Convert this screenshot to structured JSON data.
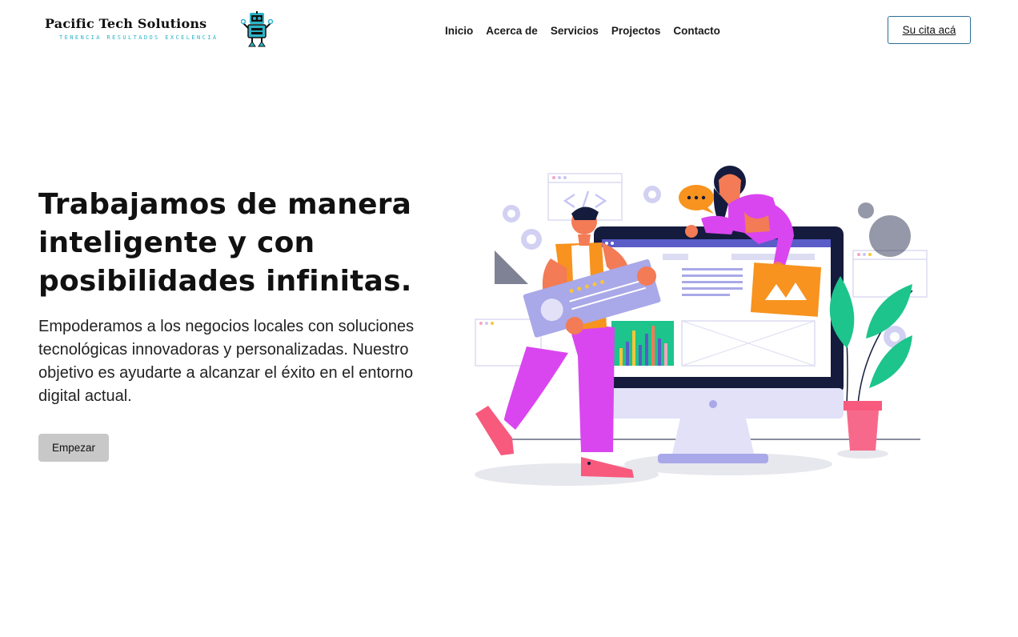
{
  "brand": {
    "name": "Pacific Tech Solutions",
    "tagline": "TENENCIA RESULTADOS EXCELENCIA"
  },
  "nav": {
    "items": [
      {
        "label": "Inicio"
      },
      {
        "label": "Acerca de"
      },
      {
        "label": "Servicios"
      },
      {
        "label": "Projectos"
      },
      {
        "label": "Contacto"
      }
    ]
  },
  "header": {
    "cta_label": "Su cita acá"
  },
  "hero": {
    "title": "Trabajamos de manera inteligente y con posibilidades infinitas.",
    "description": "Empoderamos a los negocios locales con soluciones tecnológicas innovadoras y personalizadas. Nuestro objetivo es ayudarte a alcanzar el éxito en el entorno digital actual.",
    "button_label": "Empezar"
  },
  "icons": {
    "logo_robot": "robot-icon",
    "gear": "gear-icon",
    "code": "code-icon",
    "chat": "chat-bubble-icon",
    "plant": "plant-icon"
  },
  "colors": {
    "accent": "#2bb5c9",
    "cta_border": "#2a6f93",
    "button_bg": "#c8c8c8",
    "illustration_purple": "#d946ef",
    "illustration_orange": "#f7931e",
    "illustration_green": "#1dc48b",
    "illustration_navy": "#141b3d"
  }
}
